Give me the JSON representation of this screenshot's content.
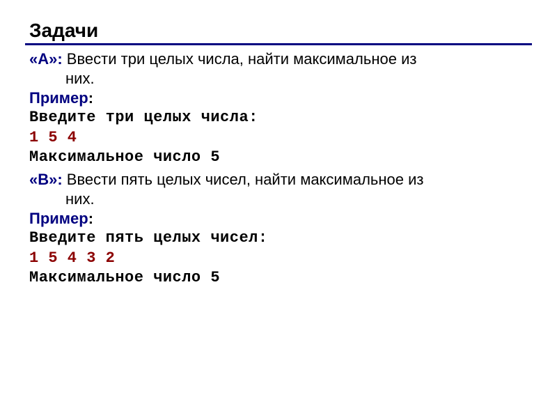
{
  "title": "Задачи",
  "taskA": {
    "label": "«A»:",
    "text_line1": " Ввести три целых числа, найти максимальное из",
    "text_line2": "них.",
    "example_label": "Пример",
    "prompt": "Введите три целых числа:",
    "input": "1 5 4",
    "result": "Максимальное число 5"
  },
  "taskB": {
    "label": "«B»:",
    "text_line1": " Ввести пять целых чисел, найти максимальное из",
    "text_line2": "них.",
    "example_label": "Пример",
    "prompt": "Введите пять целых чисел:",
    "input": "1 5 4 3 2",
    "result": "Максимальное число 5"
  }
}
